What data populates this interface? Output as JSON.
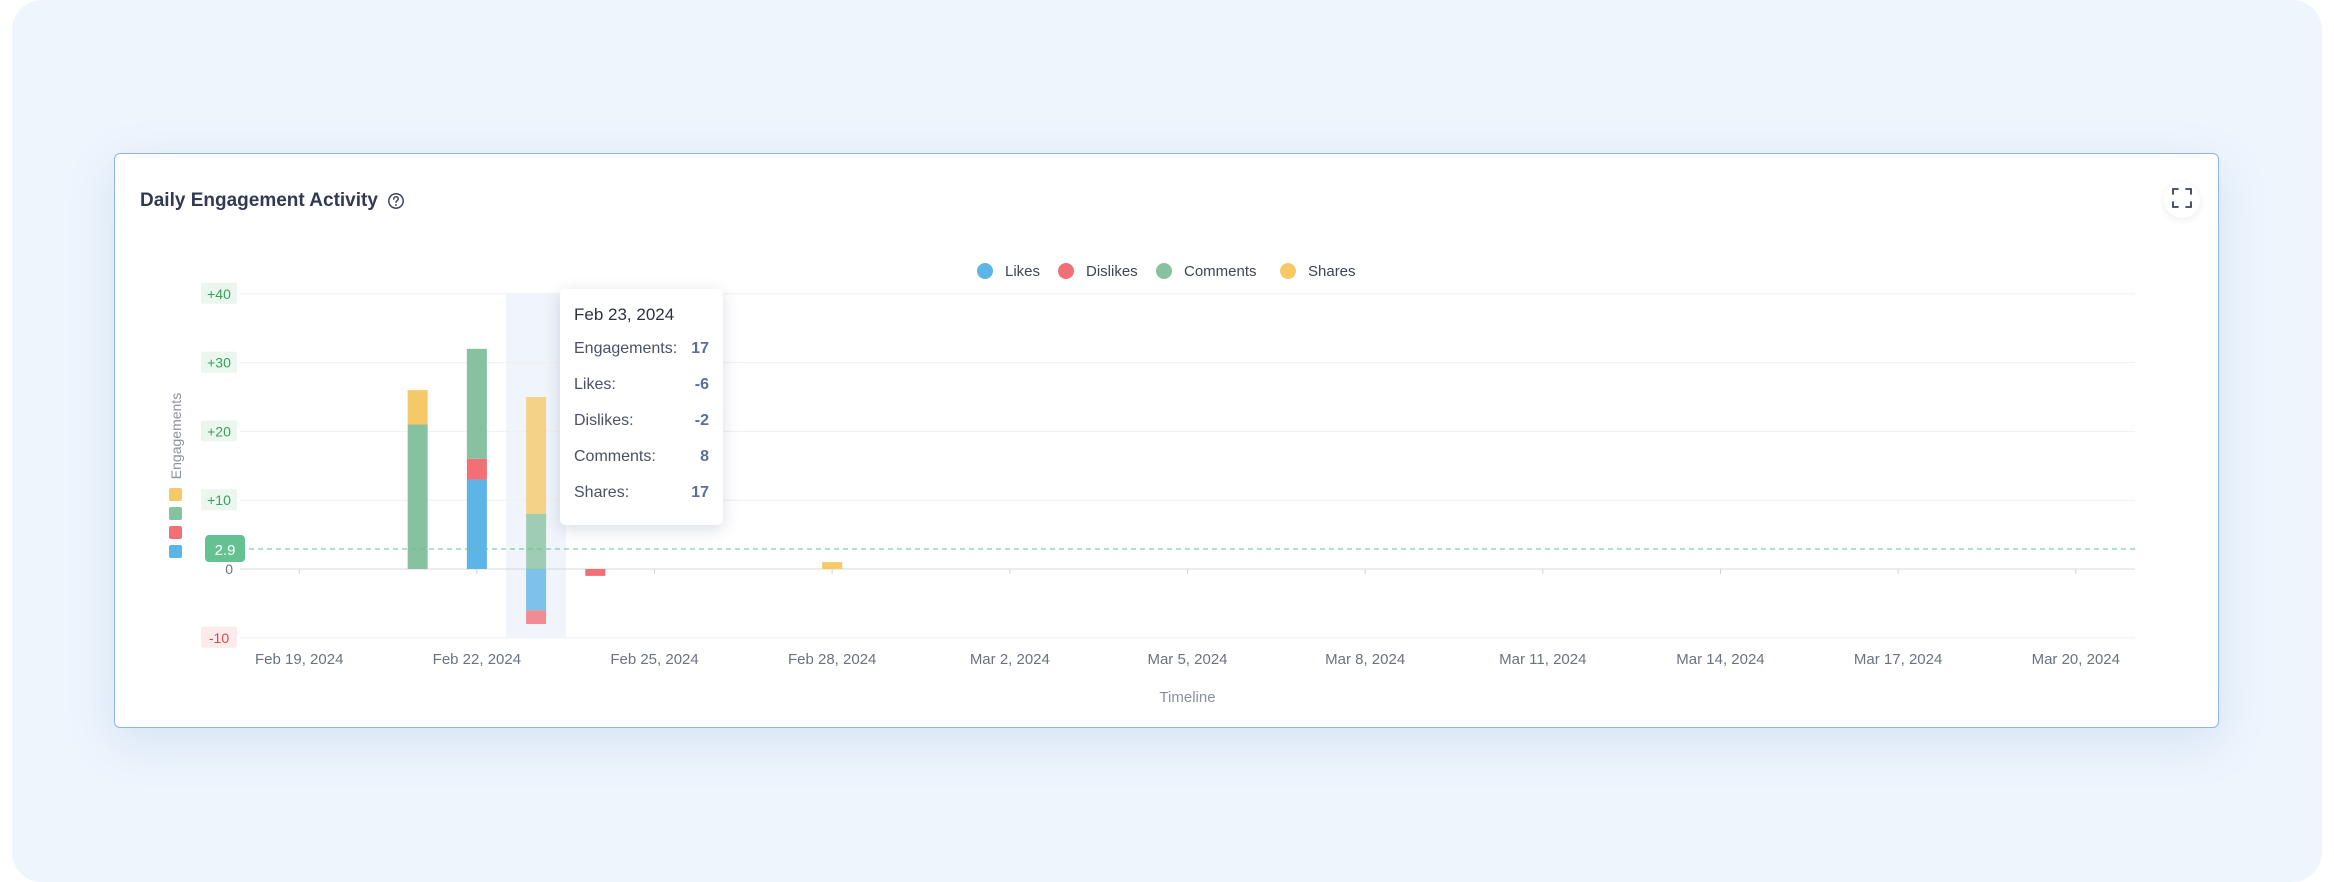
{
  "header": {
    "title": "Daily Engagement Activity",
    "help_icon": "question-circle-icon",
    "expand_icon": "fullscreen-icon"
  },
  "colors": {
    "likes": "#5db4e6",
    "dislikes": "#f07075",
    "comments": "#86c2a0",
    "shares": "#f5c968",
    "average": "#64c191",
    "card_border": "#8cb7ee"
  },
  "tooltip": {
    "date": "Feb 23, 2024",
    "rows": [
      {
        "label": "Engagements:",
        "value": "17"
      },
      {
        "label": "Likes:",
        "value": "-6"
      },
      {
        "label": "Dislikes:",
        "value": "-2"
      },
      {
        "label": "Comments:",
        "value": "8"
      },
      {
        "label": "Shares:",
        "value": "17"
      }
    ]
  },
  "chart_data": {
    "type": "bar",
    "stacked": true,
    "title": "",
    "xlabel": "Timeline",
    "ylabel": "Engagements",
    "ylim": [
      -10,
      40
    ],
    "yticks": [
      -10,
      0,
      10,
      20,
      30,
      40
    ],
    "ytick_labels": [
      "-10",
      "0",
      "+10",
      "+20",
      "+30",
      "+40"
    ],
    "x_range": [
      "2024-02-18",
      "2024-03-21"
    ],
    "x_ticks": [
      "2024-02-19",
      "2024-02-22",
      "2024-02-25",
      "2024-02-28",
      "2024-03-02",
      "2024-03-05",
      "2024-03-08",
      "2024-03-11",
      "2024-03-14",
      "2024-03-17",
      "2024-03-20"
    ],
    "x_tick_labels": [
      "Feb 19, 2024",
      "Feb 22, 2024",
      "Feb 25, 2024",
      "Feb 28, 2024",
      "Mar 2, 2024",
      "Mar 5, 2024",
      "Mar 8, 2024",
      "Mar 11, 2024",
      "Mar 14, 2024",
      "Mar 17, 2024",
      "Mar 20, 2024"
    ],
    "average_line": {
      "value": 2.9,
      "label": "2.9"
    },
    "highlighted_date": "2024-02-23",
    "grid": true,
    "legend_position": "top-center",
    "dates": [
      "2024-02-21",
      "2024-02-22",
      "2024-02-23",
      "2024-02-24",
      "2024-02-28"
    ],
    "series": [
      {
        "name": "Likes",
        "color_key": "likes",
        "values": [
          0,
          13,
          -6,
          0,
          0
        ]
      },
      {
        "name": "Dislikes",
        "color_key": "dislikes",
        "values": [
          0,
          3,
          -2,
          -1,
          0
        ]
      },
      {
        "name": "Comments",
        "color_key": "comments",
        "values": [
          21,
          16,
          8,
          0,
          0
        ]
      },
      {
        "name": "Shares",
        "color_key": "shares",
        "values": [
          5,
          0,
          17,
          0,
          1
        ]
      }
    ]
  }
}
